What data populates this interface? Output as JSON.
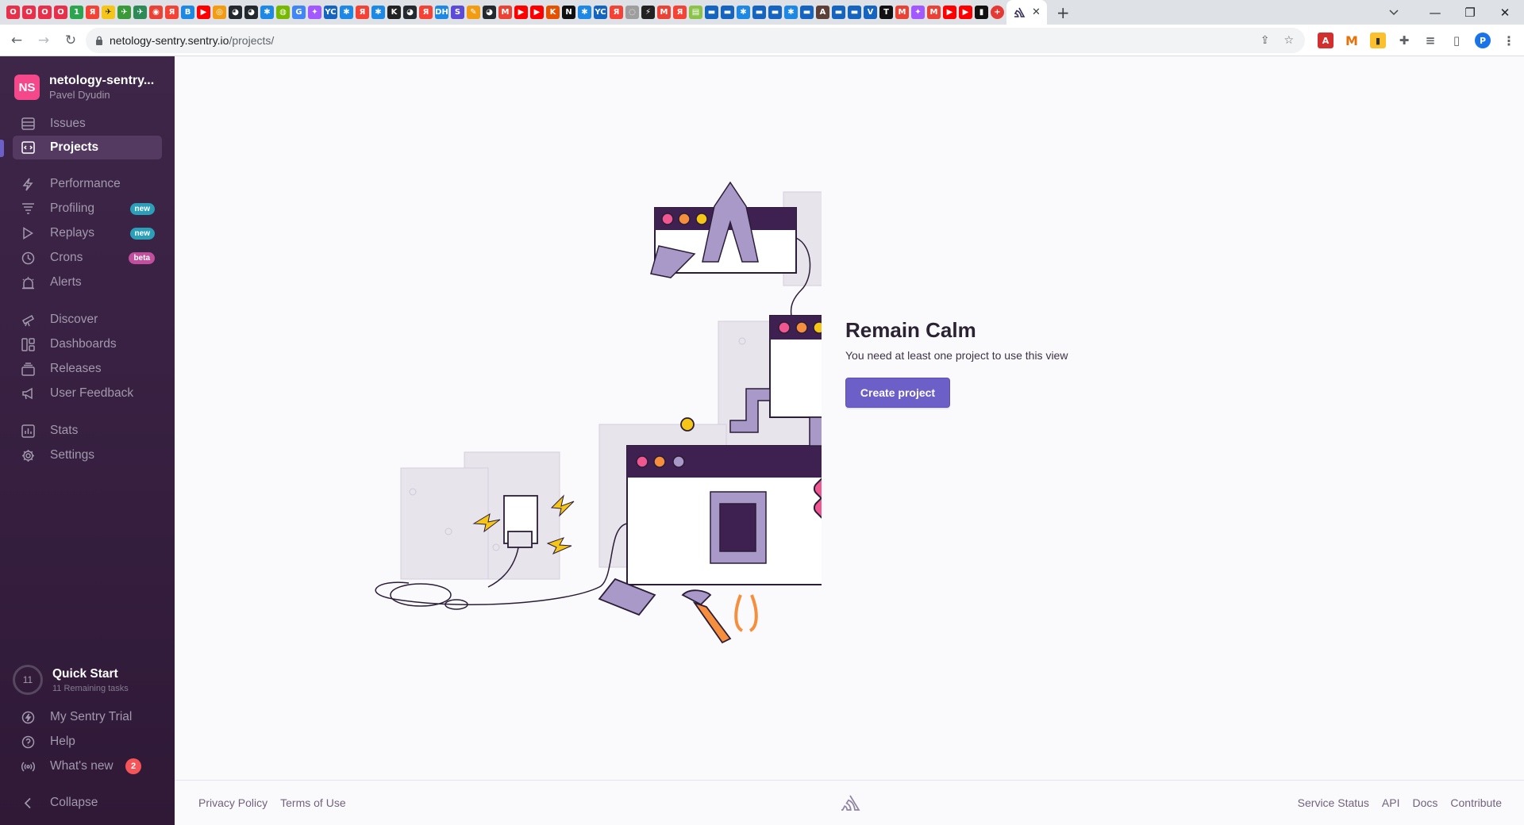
{
  "browser": {
    "url_host": "netology-sentry.sentry.io",
    "url_path": "/projects/",
    "tab_close": "✕",
    "new_tab": "+",
    "minimize": "—",
    "restore": "❐",
    "close": "✕",
    "profile_initial": "P"
  },
  "sidebar": {
    "org_initials": "NS",
    "org_name": "netology-sentry...",
    "user_name": "Pavel Dyudin",
    "items": [
      {
        "label": "Issues"
      },
      {
        "label": "Projects"
      },
      {
        "label": "Performance"
      },
      {
        "label": "Profiling",
        "badge": "new"
      },
      {
        "label": "Replays",
        "badge": "new"
      },
      {
        "label": "Crons",
        "badge": "beta"
      },
      {
        "label": "Alerts"
      },
      {
        "label": "Discover"
      },
      {
        "label": "Dashboards"
      },
      {
        "label": "Releases"
      },
      {
        "label": "User Feedback"
      },
      {
        "label": "Stats"
      },
      {
        "label": "Settings"
      }
    ],
    "quick_start": {
      "count": "11",
      "label": "Quick Start",
      "sub": "11 Remaining tasks"
    },
    "bottom": [
      {
        "label": "My Sentry Trial"
      },
      {
        "label": "Help"
      },
      {
        "label": "What's new",
        "count": "2"
      },
      {
        "label": "Collapse"
      }
    ]
  },
  "main": {
    "title": "Remain Calm",
    "subtitle": "You need at least one project to use this view",
    "cta": "Create project"
  },
  "footer": {
    "left": [
      "Privacy Policy",
      "Terms of Use"
    ],
    "right": [
      "Service Status",
      "API",
      "Docs",
      "Contribute"
    ]
  },
  "colors": {
    "accent": "#6c5fc7",
    "sidebar_top": "#3e2649",
    "sidebar_bottom": "#2f1937",
    "badge_new": "#2b9fb8",
    "badge_beta": "#c14f9d",
    "notification": "#f55459"
  }
}
